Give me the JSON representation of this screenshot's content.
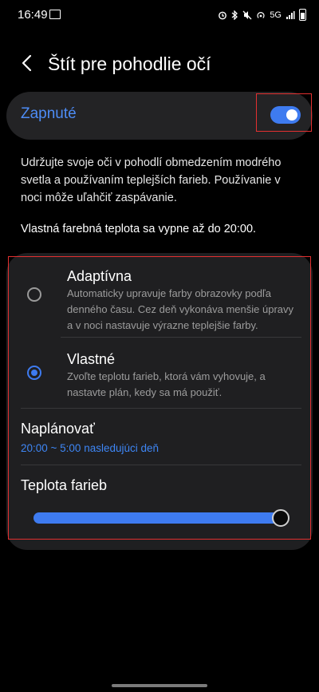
{
  "status_bar": {
    "time": "16:49",
    "icons": [
      "gallery-icon",
      "alarm-icon",
      "bluetooth-icon",
      "mute-icon",
      "hotspot-icon",
      "5g-icon",
      "signal-icon",
      "battery-icon"
    ],
    "network_label": "5G"
  },
  "header": {
    "title": "Štít pre pohodlie očí"
  },
  "master_toggle": {
    "label": "Zapnuté",
    "on": true,
    "accent": "#3e7bf0"
  },
  "description": "Udržujte svoje oči v pohodlí obmedzením modrého svetla a používaním teplejších farieb. Používanie v noci môže uľahčiť zaspávanie.",
  "limit_note": "Vlastná farebná teplota sa vypne až do 20:00.",
  "options": [
    {
      "title": "Adaptívna",
      "desc": "Automaticky upravuje farby obrazovky podľa denného času. Cez deň vykonáva menšie úpravy a v noci nastavuje výrazne teplejšie farby.",
      "selected": false
    },
    {
      "title": "Vlastné",
      "desc": "Zvoľte teplotu farieb, ktorá vám vyhovuje, a nastavte plán, kedy sa má použiť.",
      "selected": true
    }
  ],
  "schedule": {
    "title": "Naplánovať",
    "value": "20:00 ~ 5:00 nasledujúci deň"
  },
  "temperature": {
    "title": "Teplota farieb",
    "level": 1.0
  },
  "colors": {
    "accent": "#3e7bf0",
    "link": "#3e86f5",
    "highlight": "#e23030"
  }
}
